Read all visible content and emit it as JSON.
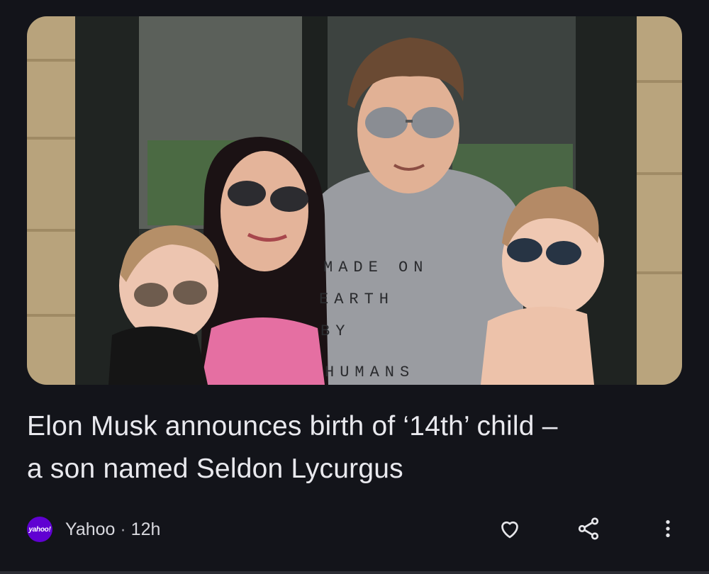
{
  "article": {
    "image_alt": "Family photo: man, woman and two babies wearing sunglasses",
    "shirt_text": [
      "MADE ON",
      "EARTH",
      "BY",
      "HUMANS"
    ],
    "headline_line1": "Elon Musk announces birth of ‘14th’ child –",
    "headline_line2": "a son named Seldon Lycurgus",
    "source": {
      "logo_text": "yahoo!",
      "name": "Yahoo",
      "separator": "·",
      "age": "12h"
    },
    "actions": {
      "like_icon": "heart-outline-icon",
      "share_icon": "share-icon",
      "more_icon": "more-vertical-icon"
    }
  },
  "colors": {
    "background": "#13141a",
    "text": "#e9e9ee",
    "yahoo_purple": "#6001d2"
  }
}
